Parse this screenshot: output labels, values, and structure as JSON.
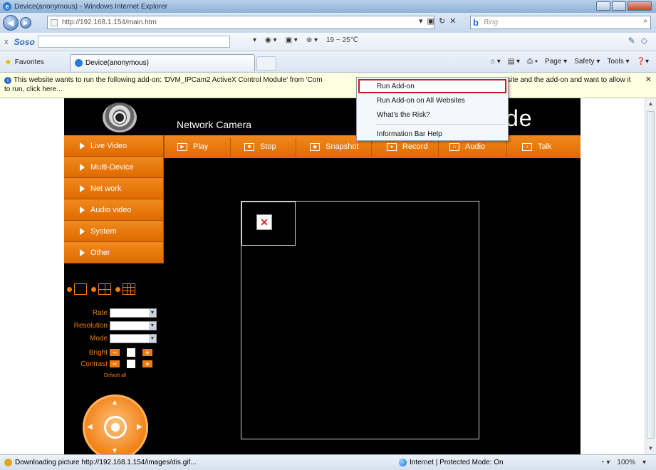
{
  "browser": {
    "window_title": "Device(anonymous) - Windows Internet Explorer",
    "url": "http://192.168.1.154/main.htm",
    "search_placeholder": "Bing",
    "soso_logo": "Soso",
    "weather": "19 ~ 25℃",
    "favorites_label": "Favorites",
    "tab_title": "Device(anonymous)",
    "command_bar": [
      "Page ▾",
      "Safety ▾",
      "Tools ▾"
    ]
  },
  "info_bar": {
    "line1": "This website wants to run the following add-on: 'DVM_IPCam2 ActiveX Control Module' from 'Com",
    "line1_tail": "site and the add-on and want to allow it",
    "line2": "to run, click here..."
  },
  "context_menu": {
    "items": [
      "Run Add-on",
      "Run Add-on on All Websites",
      "What's the Risk?"
    ],
    "help_item": "Information Bar Help"
  },
  "camera_page": {
    "brand": "Network Camera",
    "brand_right": "de",
    "menu": [
      "Live Video",
      "Multi-Device",
      "Net work",
      "Audio video",
      "System",
      "Other"
    ],
    "toolbar": {
      "play": "Play",
      "stop": "Stop",
      "snapshot": "Snapshot",
      "record": "Record",
      "audio": "Audio",
      "talk": "Talk"
    },
    "params": {
      "rate": "Rate",
      "resolution": "Resolution",
      "mode": "Mode",
      "bright": "Bright",
      "contrast": "Contrast"
    },
    "default_all": "Default all"
  },
  "status_bar": {
    "message": "Downloading picture http://192.168.1.154/images/dis.gif...",
    "zone": "Internet | Protected Mode: On",
    "zoom": "100%"
  }
}
